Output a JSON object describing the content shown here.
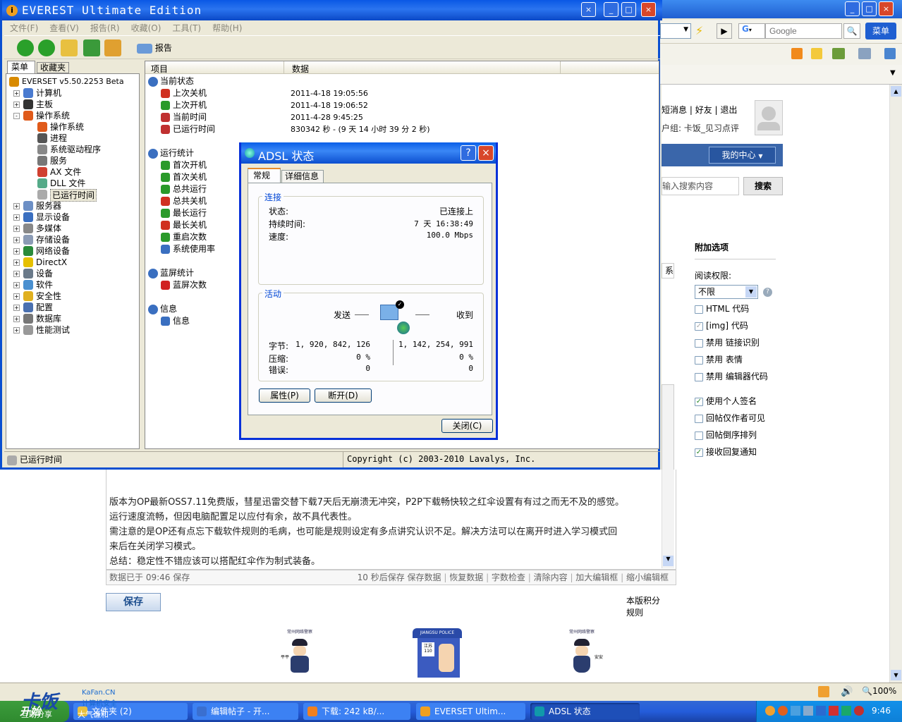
{
  "browser": {
    "search_placeholder": "Google",
    "menu_btn": "菜单",
    "user_links": [
      "短消息",
      "好友",
      "退出"
    ],
    "user_group": "户组: 卡饭_见习点评",
    "my_center": "我的中心",
    "search_input": "输入搜索内容",
    "search_btn": "搜索",
    "cut_label": "系",
    "extras_title": "附加选项",
    "read_perm": "阅读权限:",
    "read_perm_value": "不限",
    "options": [
      {
        "label": "HTML 代码",
        "checked": false
      },
      {
        "label": "[img] 代码",
        "checked": true
      },
      {
        "label": "禁用 链接识别",
        "checked": false
      },
      {
        "label": "禁用 表情",
        "checked": false
      },
      {
        "label": "禁用 编辑器代码",
        "checked": false
      },
      {
        "label": "使用个人签名",
        "checked": true
      },
      {
        "label": "回帖仅作者可见",
        "checked": false
      },
      {
        "label": "回帖倒序排列",
        "checked": false
      },
      {
        "label": "接收回复通知",
        "checked": true
      }
    ],
    "post_lines": [
      "版本为OP最新OSS7.11免费版，彗星迅雷交替下载7天后无崩溃无冲突，P2P下载畅快较之红伞设置有有过之而无不及的感觉。",
      "运行速度流畅，但因电脑配置足以应付有余，故不具代表性。",
      "需注意的是OP还有点忘下载软件规则的毛病，也可能是规则设定有多点讲究认识不足。解决方法可以在离开时进入学习模式回",
      "来后在关闭学习模式。",
      "总结：稳定性不错应该可以搭配红伞作为制式装备。"
    ],
    "saved_text": "数据已于 09:46 保存",
    "editor_links": [
      "10 秒后保存 保存数据",
      "恢复数据",
      "字数检查",
      "清除内容",
      "加大编辑框",
      "缩小编辑框"
    ],
    "save_btn": "保存",
    "rules_link": "本版积分规则",
    "zoom": "100%",
    "mascots": [
      {
        "top": "常州网络警察",
        "bottom": "平平"
      },
      {
        "top": "江苏 110",
        "bottom": "JIANGSU POLICE"
      },
      {
        "top": "常州网络警察",
        "bottom": "安安"
      }
    ]
  },
  "everest": {
    "title": "EVEREST Ultimate Edition",
    "menu": [
      "文件(F)",
      "查看(V)",
      "报告(R)",
      "收藏(O)",
      "工具(T)",
      "帮助(H)"
    ],
    "report_btn": "报告",
    "tabs": [
      "菜单",
      "收藏夹"
    ],
    "tree": [
      {
        "label": "EVERSET v5.50.2253 Beta",
        "level": 0,
        "color": "#d88a00",
        "exp": ""
      },
      {
        "label": "计算机",
        "level": 1,
        "color": "#4a7bd0",
        "exp": "+"
      },
      {
        "label": "主板",
        "level": 1,
        "color": "#333",
        "exp": "+"
      },
      {
        "label": "操作系统",
        "level": 1,
        "color": "#e05a1a",
        "exp": "-"
      },
      {
        "label": "操作系统",
        "level": 2,
        "color": "#e05a1a",
        "exp": ""
      },
      {
        "label": "进程",
        "level": 2,
        "color": "#555",
        "exp": ""
      },
      {
        "label": "系统驱动程序",
        "level": 2,
        "color": "#888",
        "exp": ""
      },
      {
        "label": "服务",
        "level": 2,
        "color": "#777",
        "exp": ""
      },
      {
        "label": "AX 文件",
        "level": 2,
        "color": "#d04030",
        "exp": ""
      },
      {
        "label": "DLL 文件",
        "level": 2,
        "color": "#5a8",
        "exp": ""
      },
      {
        "label": "已运行时间",
        "level": 2,
        "color": "#aaa",
        "exp": "",
        "selected": true
      },
      {
        "label": "服务器",
        "level": 1,
        "color": "#6c8fc5",
        "exp": "+"
      },
      {
        "label": "显示设备",
        "level": 1,
        "color": "#3a6fc0",
        "exp": "+"
      },
      {
        "label": "多媒体",
        "level": 1,
        "color": "#888",
        "exp": "+"
      },
      {
        "label": "存储设备",
        "level": 1,
        "color": "#8b9bb5",
        "exp": "+"
      },
      {
        "label": "网络设备",
        "level": 1,
        "color": "#2a8a3a",
        "exp": "+"
      },
      {
        "label": "DirectX",
        "level": 1,
        "color": "#e6c000",
        "exp": "+"
      },
      {
        "label": "设备",
        "level": 1,
        "color": "#6a7a8a",
        "exp": "+"
      },
      {
        "label": "软件",
        "level": 1,
        "color": "#4a90d0",
        "exp": "+"
      },
      {
        "label": "安全性",
        "level": 1,
        "color": "#e0b020",
        "exp": "+"
      },
      {
        "label": "配置",
        "level": 1,
        "color": "#4a70b0",
        "exp": "+"
      },
      {
        "label": "数据库",
        "level": 1,
        "color": "#777",
        "exp": "+"
      },
      {
        "label": "性能测试",
        "level": 1,
        "color": "#999",
        "exp": "+"
      }
    ],
    "col_item": "项目",
    "col_data": "数据",
    "sections": [
      {
        "title": "当前状态",
        "rows": [
          {
            "label": "上次关机",
            "value": "2011-4-18 19:05:56",
            "color": "#d03020"
          },
          {
            "label": "上次开机",
            "value": "2011-4-18 19:06:52",
            "color": "#2a9a2a"
          },
          {
            "label": "当前时间",
            "value": "2011-4-28 9:45:25",
            "color": "#c03030"
          },
          {
            "label": "已运行时间",
            "value": "830342 秒 - (9 天 14 小时 39 分 2 秒)",
            "color": "#c03030"
          }
        ]
      },
      {
        "title": "运行统计",
        "rows": [
          {
            "label": "首次开机",
            "value": "",
            "color": "#2a9a2a"
          },
          {
            "label": "首次关机",
            "value": "",
            "color": "#2a9a2a"
          },
          {
            "label": "总共运行",
            "value": "",
            "color": "#2a9a2a"
          },
          {
            "label": "总共关机",
            "value": "",
            "color": "#d03020"
          },
          {
            "label": "最长运行",
            "value": "",
            "color": "#2a9a2a"
          },
          {
            "label": "最长关机",
            "value": "",
            "color": "#d03020"
          },
          {
            "label": "重启次数",
            "value": "",
            "color": "#2a9a2a"
          },
          {
            "label": "系统使用率",
            "value": "",
            "color": "#3a6fc0"
          }
        ]
      },
      {
        "title": "蓝屏统计",
        "rows": [
          {
            "label": "蓝屏次数",
            "value": "",
            "color": "#d02020"
          }
        ]
      },
      {
        "title": "信息",
        "rows": [
          {
            "label": "信息",
            "value": "",
            "color": "#3a6fc0"
          }
        ]
      }
    ],
    "status_left": "已运行时间",
    "status_right": "Copyright (c) 2003-2010 Lavalys, Inc."
  },
  "dialog": {
    "title": "ADSL 状态",
    "tabs": [
      "常规",
      "详细信息"
    ],
    "connection_legend": "连接",
    "status_label": "状态:",
    "status_value": "已连接上",
    "duration_label": "持续时间:",
    "duration_value": "7 天 16:38:49",
    "speed_label": "速度:",
    "speed_value": "100.0 Mbps",
    "activity_legend": "活动",
    "sent": "发送",
    "received": "收到",
    "bytes_label": "字节:",
    "bytes_sent": "1, 920, 842, 126",
    "bytes_recv": "1, 142, 254, 991",
    "compress_label": "压缩:",
    "compress_sent": "0 %",
    "compress_recv": "0 %",
    "errors_label": "错误:",
    "errors_sent": "0",
    "errors_recv": "0",
    "properties_btn": "属性(P)",
    "disconnect_btn": "断开(D)",
    "close_btn": "关闭(C)"
  },
  "taskbar": {
    "start": "开始",
    "tasks": [
      "文件夹 (2)",
      "编辑帖子 - 开...",
      "下载: 242 kB/...",
      "EVERSET Ultim...",
      "ADSL 状态"
    ],
    "time": "9:46",
    "logo": "卡饭",
    "logo_url": "KaFan.CN",
    "logo_sub": "计算机安全",
    "logo_left": "互助分享",
    "logo_mid": "大气谦和"
  }
}
